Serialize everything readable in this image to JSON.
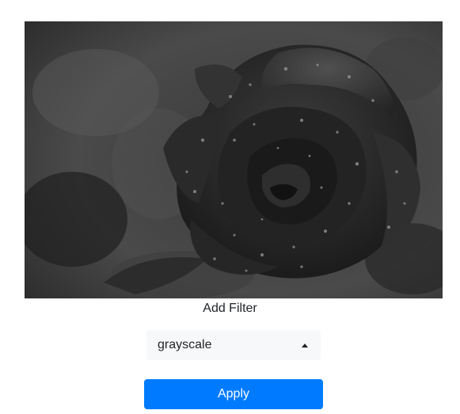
{
  "image": {
    "subject": "rose-with-water-droplets",
    "filter_applied": "grayscale"
  },
  "filter_section": {
    "label": "Add Filter",
    "select": {
      "selected_value": "grayscale"
    },
    "apply_label": "Apply"
  },
  "colors": {
    "accent": "#007bff",
    "select_background": "#f7f8f9",
    "text": "#212529"
  }
}
